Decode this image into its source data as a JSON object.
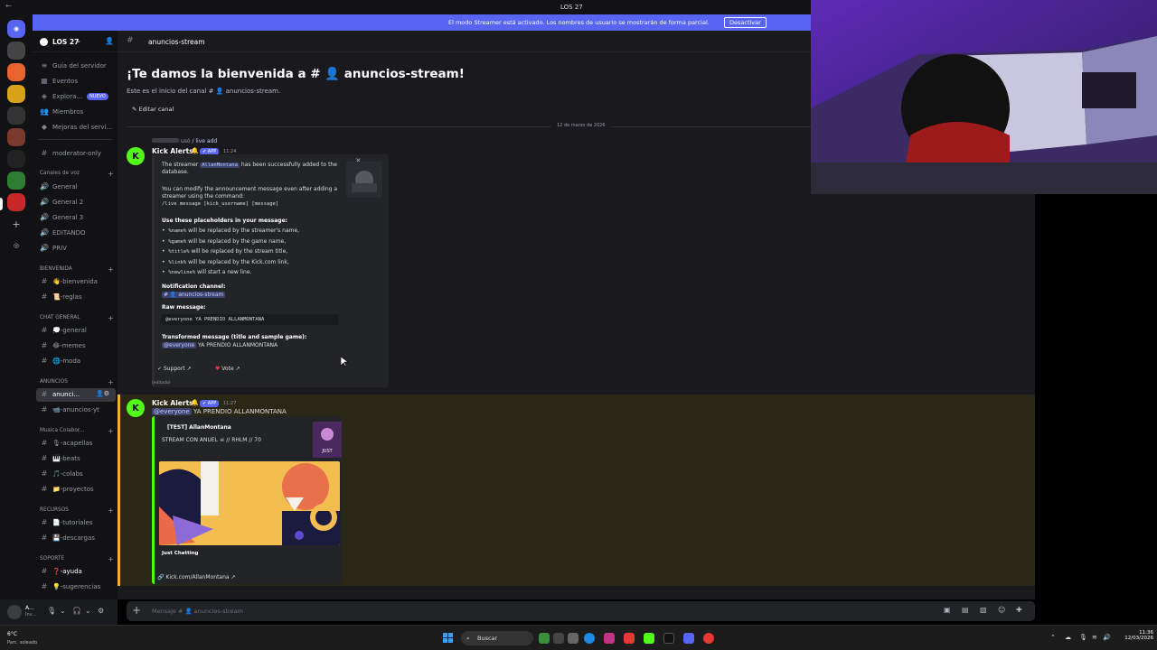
{
  "window": {
    "title": "LOS 27",
    "back": "←"
  },
  "banner": {
    "text": "El modo Streamer está activado. Los nombres de usuario se mostrarán de forma parcial.",
    "button": "Desactivar",
    "color": "#5865f2"
  },
  "server": {
    "name": "LOS 27",
    "nav": [
      {
        "label": "Guía del servidor",
        "icon": "guide-icon"
      },
      {
        "label": "Eventos",
        "icon": "calendar-icon"
      },
      {
        "label": "Explora...",
        "icon": "compass-icon",
        "badge": "NUEVO"
      },
      {
        "label": "Miembros",
        "icon": "members-icon"
      },
      {
        "label": "Mejoras del servi...",
        "icon": "boost-icon"
      }
    ],
    "channels_top": [
      {
        "label": "moderator-only"
      }
    ],
    "voice_category": "Canales de voz",
    "voice_channels": [
      {
        "label": "General"
      },
      {
        "label": "General 2"
      },
      {
        "label": "General 3"
      },
      {
        "label": "EDITANDO"
      },
      {
        "label": "PRIV"
      }
    ],
    "categories": [
      {
        "name": "BIENVENIDA",
        "channels": [
          "👋-bienvenida",
          "📜-reglas"
        ]
      },
      {
        "name": "CHAT GENERAL",
        "channels": [
          "💭-general",
          "😂-memes",
          "🌐-moda"
        ]
      },
      {
        "name": "ANUNCIOS",
        "channels": [
          "anunci...",
          "📹-anuncios-yt"
        ]
      },
      {
        "name": "Musica Colabor...",
        "channels": [
          "🎙-acapellas",
          "🎹-beats",
          "🎵-colabs",
          "📁-proyectos"
        ]
      },
      {
        "name": "RECURSOS",
        "channels": [
          "📄-tutoriales",
          "💾-descargas"
        ]
      },
      {
        "name": "SOPORTE",
        "channels": [
          "❓-ayuda",
          "💡-sugerencias"
        ]
      }
    ]
  },
  "user": {
    "name": "A...",
    "status": "Inv..."
  },
  "channel": {
    "name": "anuncios-stream",
    "welcome_title": "¡Te damos la bienvenida a # 👤 anuncios-stream!",
    "welcome_sub": "Este es el inicio del canal # 👤 anuncios-stream.",
    "edit_button": "Editar canal",
    "date": "12 de marzo de 2026"
  },
  "msg1": {
    "reply_used": "usó",
    "reply_cmd": "/ live add",
    "author": "Kick Alerts",
    "tag": "✔ APP",
    "time": "11:24",
    "embed": {
      "line1a": "The streamer",
      "line1b": "AllanMontana",
      "line1c": "has been successfully added to the",
      "line1d": "database.",
      "line2": "You can modify the announcement message even after adding a",
      "line3": "streamer using the command:",
      "line4": "/live message [kick_username] [message]",
      "placeholders_title": "Use these placeholders in your message:",
      "p1a": "%name%",
      "p1b": "will be replaced by the streamer's name,",
      "p2a": "%game%",
      "p2b": "will be replaced by the game name,",
      "p3a": "%title%",
      "p3b": "will be replaced by the stream title,",
      "p4a": "%link%",
      "p4b": "will be replaced by the Kick.com link,",
      "p5a": "%newline%",
      "p5b": "will start a new line.",
      "notif_title": "Notification channel:",
      "notif_channel": "# 👤 anuncios-stream",
      "raw_title": "Raw message:",
      "raw_value": "@everyone  YA PRENDIO ALLANMONTANA",
      "trans_title": "Transformed message (title and sample game):",
      "trans_mention": "@everyone",
      "trans_value": "YA PRENDIO ALLANMONTANA"
    },
    "support_btn": "Support",
    "vote_btn": "Vote",
    "edited": "(editado)"
  },
  "msg2": {
    "author": "Kick Alerts",
    "tag": "✔ APP",
    "time": "11:27",
    "mention": "@everyone",
    "text": "YA PRENDIO ALLANMONTANA",
    "embed_author": "[TEST] AllanMontana",
    "embed_title": "STREAM CON ANUEL ☠ // RHLM // 70",
    "category": "Just Chatting",
    "link": "Kick.com/AllanMontana",
    "accent": "#53fc18"
  },
  "composer": {
    "placeholder": "Mensaje # 👤 anuncios-stream"
  },
  "taskbar": {
    "weather": "6°C",
    "weather_desc": "Parc. soleado",
    "search": "Buscar",
    "time": "11:36",
    "date": "12/03/2026"
  }
}
